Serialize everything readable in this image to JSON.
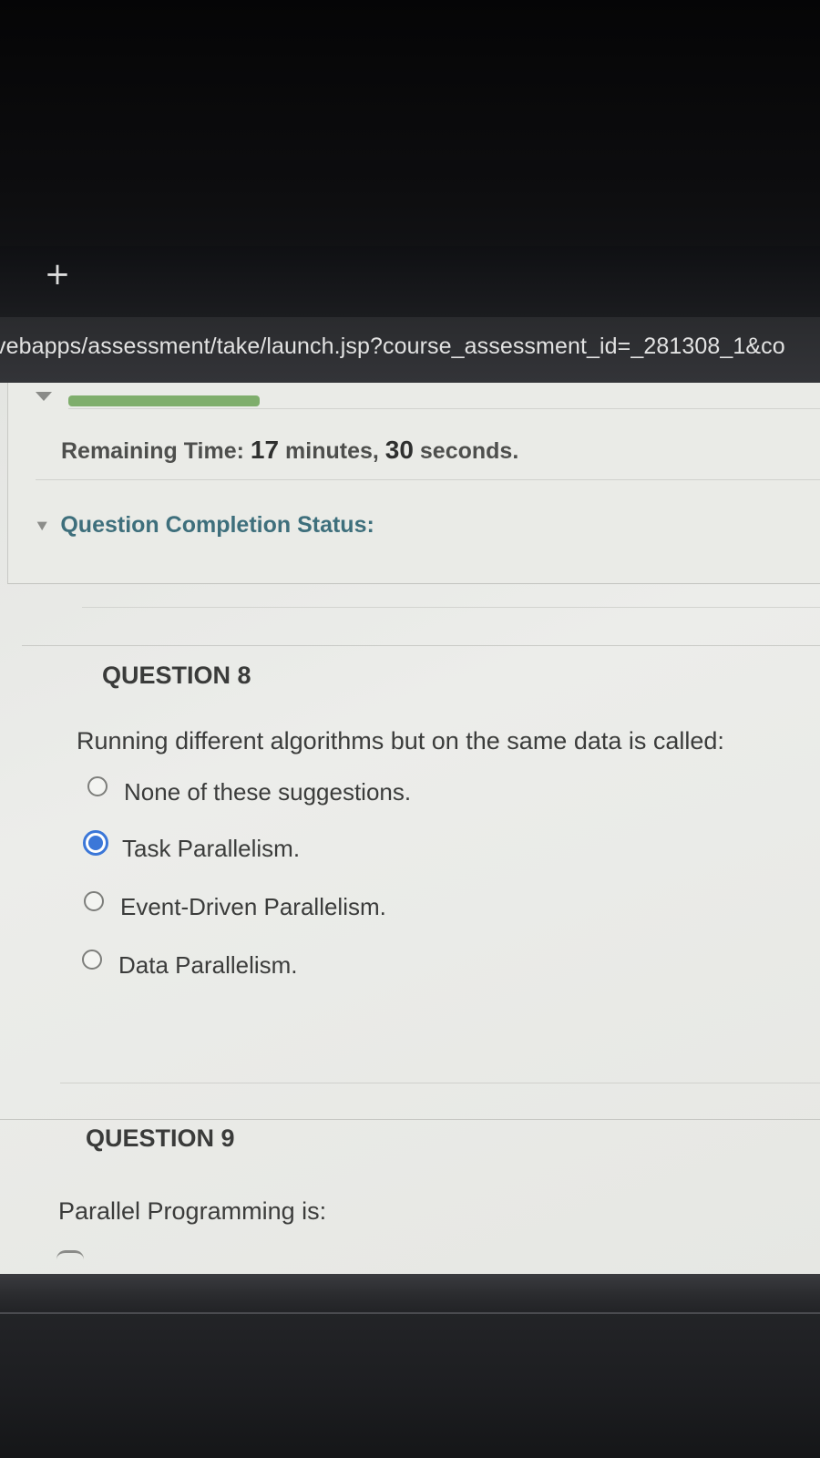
{
  "browser": {
    "new_tab_label": "+",
    "url": "vebapps/assessment/take/launch.jsp?course_assessment_id=_281308_1&co"
  },
  "status_panel": {
    "progress_fraction": 0.25,
    "remaining_label": "Remaining Time:",
    "minutes_value": "17",
    "minutes_label": "minutes,",
    "seconds_value": "30",
    "seconds_label": "seconds.",
    "completion_icon": "double-chevron-down-icon",
    "completion_label": "Question Completion Status:"
  },
  "questions": [
    {
      "title": "QUESTION 8",
      "text": "Running different algorithms but on the same data  is called:",
      "options": [
        {
          "label": "None of these suggestions.",
          "selected": false
        },
        {
          "label": "Task Parallelism.",
          "selected": true
        },
        {
          "label": "Event-Driven Parallelism.",
          "selected": false
        },
        {
          "label": "Data Parallelism.",
          "selected": false
        }
      ]
    },
    {
      "title": "QUESTION 9",
      "text": "Parallel Programming is:"
    }
  ],
  "colors": {
    "progress": "#7fae6c",
    "link": "#3e6f7c",
    "radio_selected": "#3b77d8"
  }
}
